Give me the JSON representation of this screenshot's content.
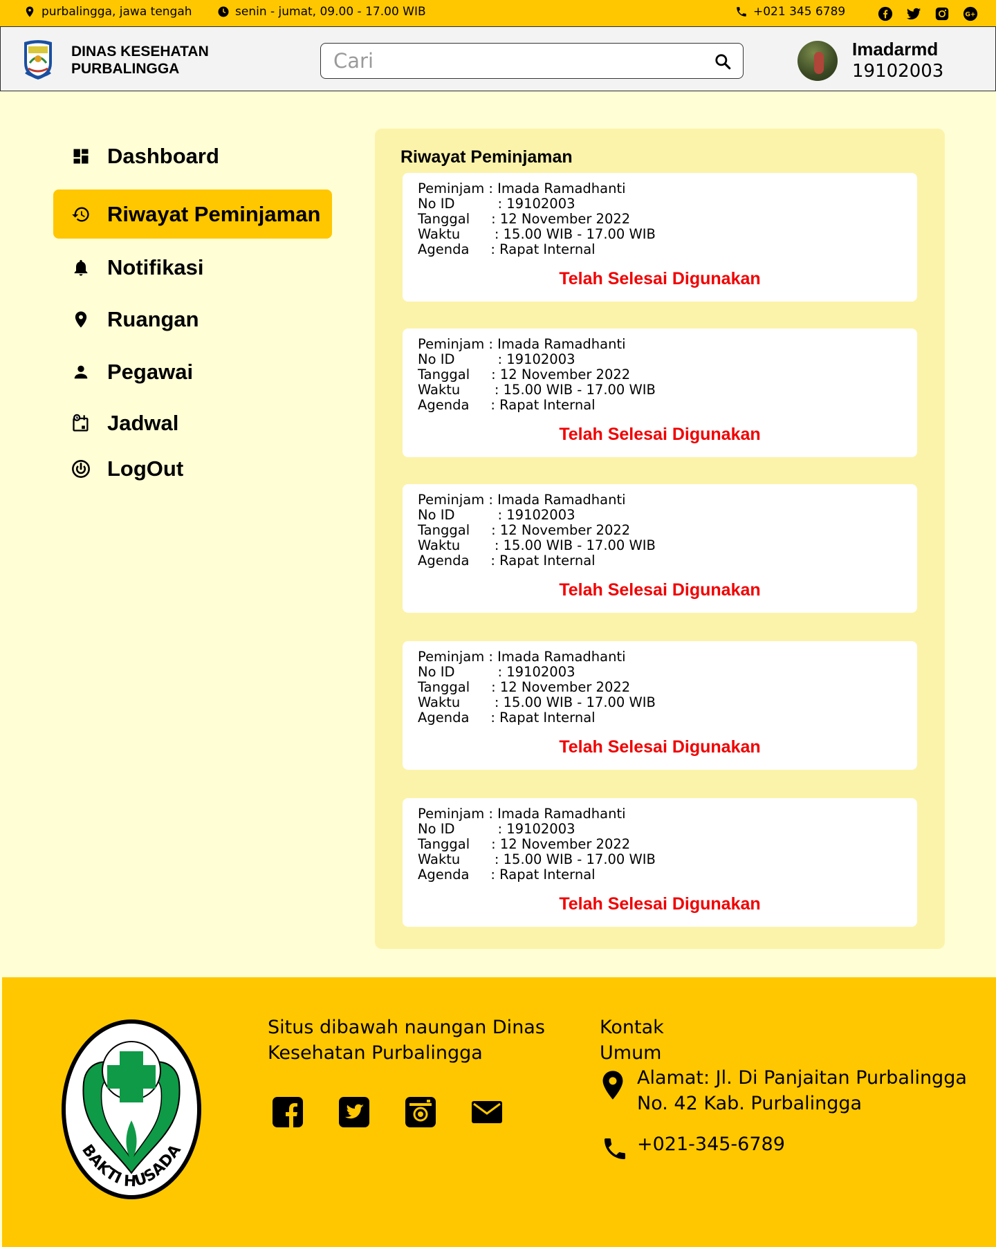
{
  "topbar": {
    "location": "purbalingga,  jawa tengah",
    "hours": "senin - jumat, 09.00 - 17.00 WIB",
    "phone": "+021 345 6789",
    "social_icons": [
      "facebook-icon",
      "twitter-icon",
      "instagram-icon",
      "google-plus-icon"
    ]
  },
  "header": {
    "brand_line1": "DINAS KESEHATAN",
    "brand_line2": "PURBALINGGA",
    "search_placeholder": "Cari",
    "search_value": "",
    "user_name": "Imadarmd",
    "user_id": "19102003"
  },
  "sidebar": {
    "items": [
      {
        "label": "Dashboard",
        "icon": "dashboard-icon",
        "active": false
      },
      {
        "label": "Riwayat Peminjaman",
        "icon": "history-icon",
        "active": true
      },
      {
        "label": "Notifikasi",
        "icon": "bell-icon",
        "active": false
      },
      {
        "label": "Ruangan",
        "icon": "location-pin-icon",
        "active": false
      },
      {
        "label": "Pegawai",
        "icon": "person-icon",
        "active": false
      },
      {
        "label": "Jadwal",
        "icon": "schedule-icon",
        "active": false
      },
      {
        "label": "LogOut",
        "icon": "power-icon",
        "active": false
      }
    ]
  },
  "main": {
    "title": "Riwayat Peminjaman",
    "labels": {
      "peminjam": "Peminjam : ",
      "no_id": "No ID          : ",
      "tanggal": "Tanggal     : ",
      "waktu": "Waktu        : ",
      "agenda": "Agenda     : "
    },
    "records": [
      {
        "peminjam": "Imada Ramadhanti",
        "no_id": "19102003",
        "tanggal": "12 November 2022",
        "waktu": "15.00 WIB - 17.00 WIB",
        "agenda": "Rapat Internal",
        "status": "Telah Selesai Digunakan"
      },
      {
        "peminjam": "Imada Ramadhanti",
        "no_id": "19102003",
        "tanggal": "12 November 2022",
        "waktu": "15.00 WIB - 17.00 WIB",
        "agenda": "Rapat Internal",
        "status": "Telah Selesai Digunakan"
      },
      {
        "peminjam": "Imada Ramadhanti",
        "no_id": "19102003",
        "tanggal": "12 November 2022",
        "waktu": "15.00 WIB - 17.00 WIB",
        "agenda": "Rapat Internal",
        "status": "Telah Selesai Digunakan"
      },
      {
        "peminjam": "Imada Ramadhanti",
        "no_id": "19102003",
        "tanggal": "12 November 2022",
        "waktu": "15.00 WIB - 17.00 WIB",
        "agenda": "Rapat Internal",
        "status": "Telah Selesai Digunakan"
      },
      {
        "peminjam": "Imada Ramadhanti",
        "no_id": "19102003",
        "tanggal": "12 November 2022",
        "waktu": "15.00 WIB - 17.00 WIB",
        "agenda": "Rapat Internal",
        "status": "Telah Selesai Digunakan"
      }
    ]
  },
  "footer": {
    "logo_text": "BAKTI HUSADA",
    "about_line1": "Situs dibawah naungan Dinas",
    "about_line2": "Kesehatan Purbalingga",
    "social_icons": [
      "facebook-icon",
      "twitter-icon",
      "instagram-icon",
      "mail-icon"
    ],
    "kontak_line1": "Kontak",
    "kontak_line2": "Umum",
    "address_line1": "Alamat: Jl. Di Panjaitan Purbalingga",
    "address_line2": "No. 42 Kab. Purbalingga",
    "phone": "+021-345-6789"
  },
  "colors": {
    "accent": "#FFC700",
    "page_bg": "#FFFED5",
    "panel_bg": "#FCF3AA",
    "status_red": "#F00000",
    "logo_green": "#0E9A47"
  }
}
